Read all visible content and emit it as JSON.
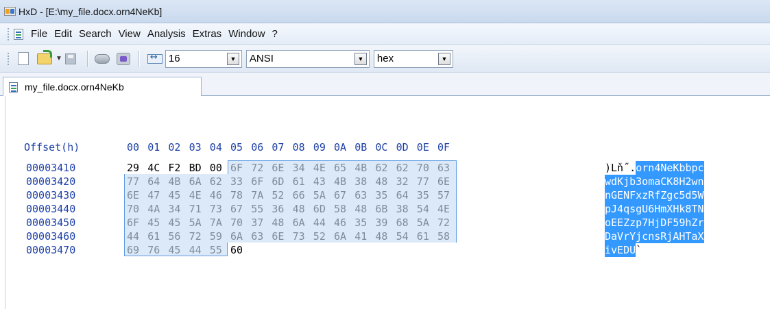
{
  "window": {
    "title": "HxD - [E:\\my_file.docx.orn4NeKb]"
  },
  "menu": [
    "File",
    "Edit",
    "Search",
    "View",
    "Analysis",
    "Extras",
    "Window",
    "?"
  ],
  "toolbar": {
    "bytes_per_row": "16",
    "charset": "ANSI",
    "offset_base": "hex"
  },
  "tab": {
    "label": "my_file.docx.orn4NeKb"
  },
  "editor": {
    "offset_header": "Offset(h)",
    "columns": [
      "00",
      "01",
      "02",
      "03",
      "04",
      "05",
      "06",
      "07",
      "08",
      "09",
      "0A",
      "0B",
      "0C",
      "0D",
      "0E",
      "0F"
    ],
    "rows": [
      {
        "offset": "00003410",
        "bytes": [
          "29",
          "4C",
          "F2",
          "BD",
          "00",
          "6F",
          "72",
          "6E",
          "34",
          "4E",
          "65",
          "4B",
          "62",
          "62",
          "70",
          "63"
        ],
        "ascii_plain": ")Lň˝.",
        "ascii_sel": "orn4NeKbbpc"
      },
      {
        "offset": "00003420",
        "bytes": [
          "77",
          "64",
          "4B",
          "6A",
          "62",
          "33",
          "6F",
          "6D",
          "61",
          "43",
          "4B",
          "38",
          "48",
          "32",
          "77",
          "6E"
        ],
        "ascii_plain": "",
        "ascii_sel": "wdKjb3omaCK8H2wn"
      },
      {
        "offset": "00003430",
        "bytes": [
          "6E",
          "47",
          "45",
          "4E",
          "46",
          "78",
          "7A",
          "52",
          "66",
          "5A",
          "67",
          "63",
          "35",
          "64",
          "35",
          "57"
        ],
        "ascii_plain": "",
        "ascii_sel": "nGENFxzRfZgc5d5W"
      },
      {
        "offset": "00003440",
        "bytes": [
          "70",
          "4A",
          "34",
          "71",
          "73",
          "67",
          "55",
          "36",
          "48",
          "6D",
          "58",
          "48",
          "6B",
          "38",
          "54",
          "4E"
        ],
        "ascii_plain": "",
        "ascii_sel": "pJ4qsgU6HmXHk8TN"
      },
      {
        "offset": "00003450",
        "bytes": [
          "6F",
          "45",
          "45",
          "5A",
          "7A",
          "70",
          "37",
          "48",
          "6A",
          "44",
          "46",
          "35",
          "39",
          "68",
          "5A",
          "72"
        ],
        "ascii_plain": "",
        "ascii_sel": "oEEZzp7HjDF59hZr"
      },
      {
        "offset": "00003460",
        "bytes": [
          "44",
          "61",
          "56",
          "72",
          "59",
          "6A",
          "63",
          "6E",
          "73",
          "52",
          "6A",
          "41",
          "48",
          "54",
          "61",
          "58"
        ],
        "ascii_plain": "",
        "ascii_sel": "DaVrYjcnsRjAHTaX"
      },
      {
        "offset": "00003470",
        "bytes": [
          "69",
          "76",
          "45",
          "44",
          "55",
          "60"
        ],
        "ascii_plain": "",
        "ascii_sel": "ivEDU",
        "ascii_tail": "`"
      }
    ]
  },
  "colors": {
    "offset_blue": "#1c3fa8",
    "selection_bg": "#dce9f8",
    "selection_border": "#5b9be0",
    "ascii_selection": "#3399ff"
  }
}
